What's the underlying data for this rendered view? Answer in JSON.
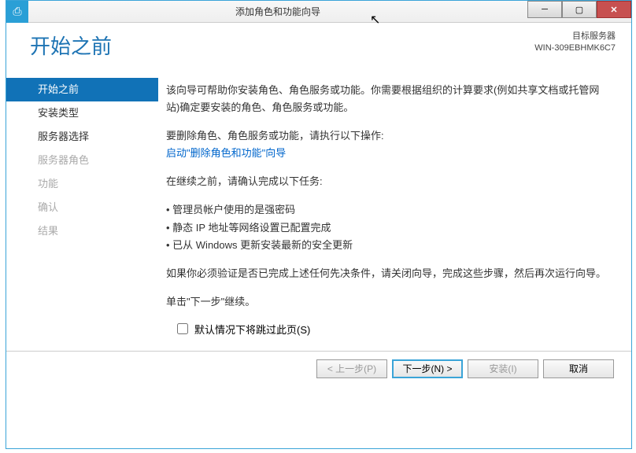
{
  "window": {
    "title": "添加角色和功能向导",
    "minimize": "─",
    "maximize": "▢",
    "close": "✕"
  },
  "header": {
    "heading": "开始之前",
    "target_label": "目标服务器",
    "target_value": "WIN-309EBHMK6C7"
  },
  "sidebar": {
    "items": [
      {
        "label": "开始之前"
      },
      {
        "label": "安装类型"
      },
      {
        "label": "服务器选择"
      },
      {
        "label": "服务器角色"
      },
      {
        "label": "功能"
      },
      {
        "label": "确认"
      },
      {
        "label": "结果"
      }
    ]
  },
  "content": {
    "intro": "该向导可帮助你安装角色、角色服务或功能。你需要根据组织的计算要求(例如共享文档或托管网站)确定要安装的角色、角色服务或功能。",
    "remove_label": "要删除角色、角色服务或功能，请执行以下操作:",
    "remove_link": "启动\"删除角色和功能\"向导",
    "confirm_label": "在继续之前，请确认完成以下任务:",
    "bullets": [
      "管理员帐户使用的是强密码",
      "静态 IP 地址等网络设置已配置完成",
      "已从 Windows 更新安装最新的安全更新"
    ],
    "verify": "如果你必须验证是否已完成上述任何先决条件，请关闭向导，完成这些步骤，然后再次运行向导。",
    "continue": "单击\"下一步\"继续。"
  },
  "skip": {
    "label": "默认情况下将跳过此页(S)"
  },
  "buttons": {
    "prev": "< 上一步(P)",
    "next": "下一步(N) >",
    "install": "安装(I)",
    "cancel": "取消"
  }
}
